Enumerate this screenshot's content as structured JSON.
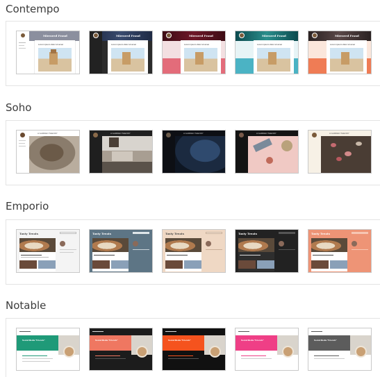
{
  "sections": {
    "contempo": {
      "title": "Contempo",
      "themes": [
        {
          "heading": "Mirrored Fraud",
          "post": "Lorem ipsum dolor sit amet"
        },
        {
          "heading": "Mirrored Fraud",
          "post": "Lorem ipsum dolor sit amet"
        },
        {
          "heading": "Mirrored Fraud",
          "post": "Lorem ipsum dolor sit amet"
        },
        {
          "heading": "Mirrored Fraud",
          "post": "Lorem ipsum dolor sit amet"
        },
        {
          "heading": "Mirrored Fraud",
          "post": "Lorem ipsum dolor sit amet"
        }
      ]
    },
    "soho": {
      "title": "Soho",
      "themes": [
        {
          "blog_name": "A GARDEN THEORY"
        },
        {
          "blog_name": "A GARDEN THEORY"
        },
        {
          "blog_name": "A GARDEN THEORY"
        },
        {
          "blog_name": "A GARDEN THEORY"
        },
        {
          "blog_name": "A GARDEN THEORY"
        }
      ]
    },
    "emporio": {
      "title": "Emporio",
      "themes": [
        {
          "blog_name": "Tasty Treats"
        },
        {
          "blog_name": "Tasty Treats"
        },
        {
          "blog_name": "Tasty Treats"
        },
        {
          "blog_name": "Tasty Treats"
        },
        {
          "blog_name": "Tasty Treats"
        }
      ]
    },
    "notable": {
      "title": "Notable",
      "themes": [
        {
          "post_title": "Social Media \"Friends\""
        },
        {
          "post_title": "Social Media \"Friends\""
        },
        {
          "post_title": "Social Media \"Friends\""
        },
        {
          "post_title": "Social Media \"Friends\""
        },
        {
          "post_title": "Social Media \"Friends\""
        }
      ]
    }
  }
}
